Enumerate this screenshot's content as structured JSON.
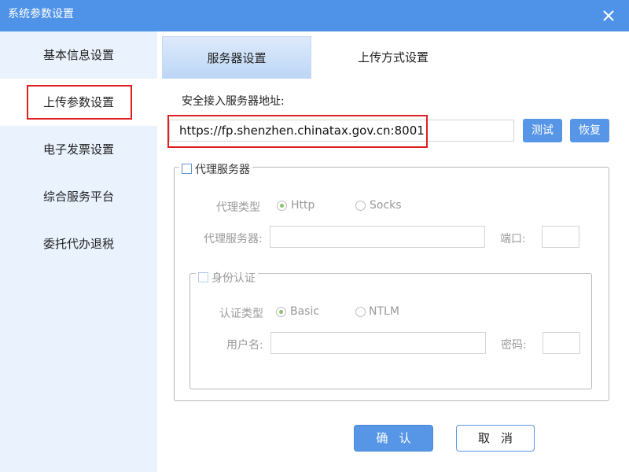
{
  "window": {
    "title": "系统参数设置"
  },
  "sidebar": {
    "items": [
      {
        "label": "基本信息设置"
      },
      {
        "label": "上传参数设置"
      },
      {
        "label": "电子发票设置"
      },
      {
        "label": "综合服务平台"
      },
      {
        "label": "委托代办退税"
      }
    ],
    "active": "上传参数设置"
  },
  "tabs": [
    {
      "label": "服务器设置"
    },
    {
      "label": "上传方式设置"
    }
  ],
  "server": {
    "label": "安全接入服务器地址:",
    "url": "https://fp.shenzhen.chinatax.gov.cn:8001",
    "test_label": "测试",
    "restore_label": "恢复"
  },
  "proxy": {
    "checkbox_label": "代理服务器",
    "type_label": "代理类型",
    "type_options": [
      "Http",
      "Socks"
    ],
    "type_selected": "Http",
    "server_label": "代理服务器:",
    "server_value": "",
    "port_label": "端口:",
    "port_value": ""
  },
  "auth": {
    "checkbox_label": "身份认证",
    "type_label": "认证类型",
    "type_options": [
      "Basic",
      "NTLM"
    ],
    "type_selected": "Basic",
    "username_label": "用户名:",
    "username_value": "",
    "password_label": "密码:",
    "password_value": ""
  },
  "footer": {
    "ok_label": "确认",
    "cancel_label": "取消"
  },
  "colors": {
    "accent": "#4f93e8",
    "button": "#5796e6",
    "sidebar_bg": "#e9f2fd",
    "highlight": "#e02020"
  }
}
